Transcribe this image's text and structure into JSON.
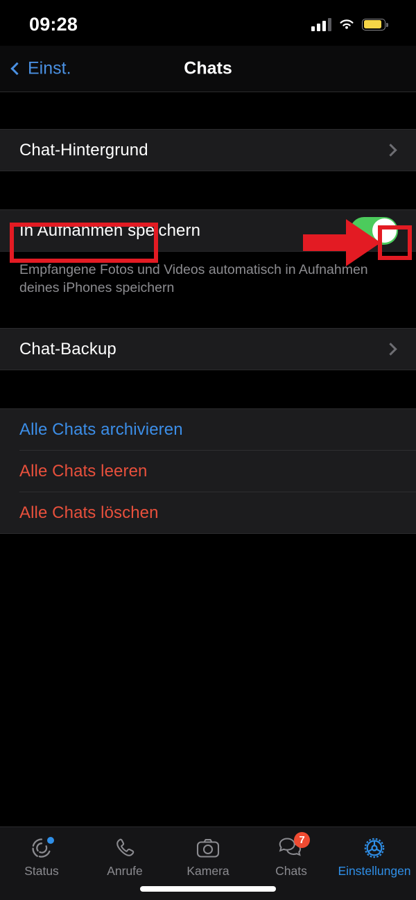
{
  "status_bar": {
    "time": "09:28",
    "signal_icon": "cellular-bars-icon",
    "wifi_icon": "wifi-icon",
    "battery_icon": "battery-low-power-icon",
    "battery_color": "#f5d547"
  },
  "nav": {
    "back_label": "Einst.",
    "back_icon": "chevron-left-icon",
    "title": "Chats",
    "accent_color": "#4a90e2"
  },
  "sections": {
    "wallpaper": {
      "rows": [
        {
          "label": "Chat-Hintergrund",
          "accessory": "chevron-right-icon"
        }
      ]
    },
    "media": {
      "rows": [
        {
          "label": "In Aufnahmen speichern",
          "accessory": "toggle",
          "toggle_on": true
        }
      ],
      "footer": "Empfangene Fotos und Videos automatisch in Aufnahmen deines iPhones speichern"
    },
    "backup": {
      "rows": [
        {
          "label": "Chat-Backup",
          "accessory": "chevron-right-icon"
        }
      ]
    },
    "actions": {
      "rows": [
        {
          "label": "Alle Chats archivieren",
          "style": "blue"
        },
        {
          "label": "Alle Chats leeren",
          "style": "red"
        },
        {
          "label": "Alle Chats löschen",
          "style": "red"
        }
      ]
    }
  },
  "annotations": {
    "highlight_color": "#e31b23",
    "label_box_target": "Chat-Hintergrund",
    "chevron_box_target": "chevron-right-icon",
    "arrow_direction": "right"
  },
  "tabbar": {
    "items": [
      {
        "label": "Status",
        "icon": "status-ring-icon",
        "active": false,
        "dot": true
      },
      {
        "label": "Anrufe",
        "icon": "phone-icon",
        "active": false
      },
      {
        "label": "Kamera",
        "icon": "camera-icon",
        "active": false
      },
      {
        "label": "Chats",
        "icon": "chat-bubbles-icon",
        "active": false,
        "badge": "7"
      },
      {
        "label": "Einstellungen",
        "icon": "gear-icon",
        "active": true
      }
    ],
    "active_color": "#2f8fe8",
    "badge_color": "#ef4b32"
  }
}
